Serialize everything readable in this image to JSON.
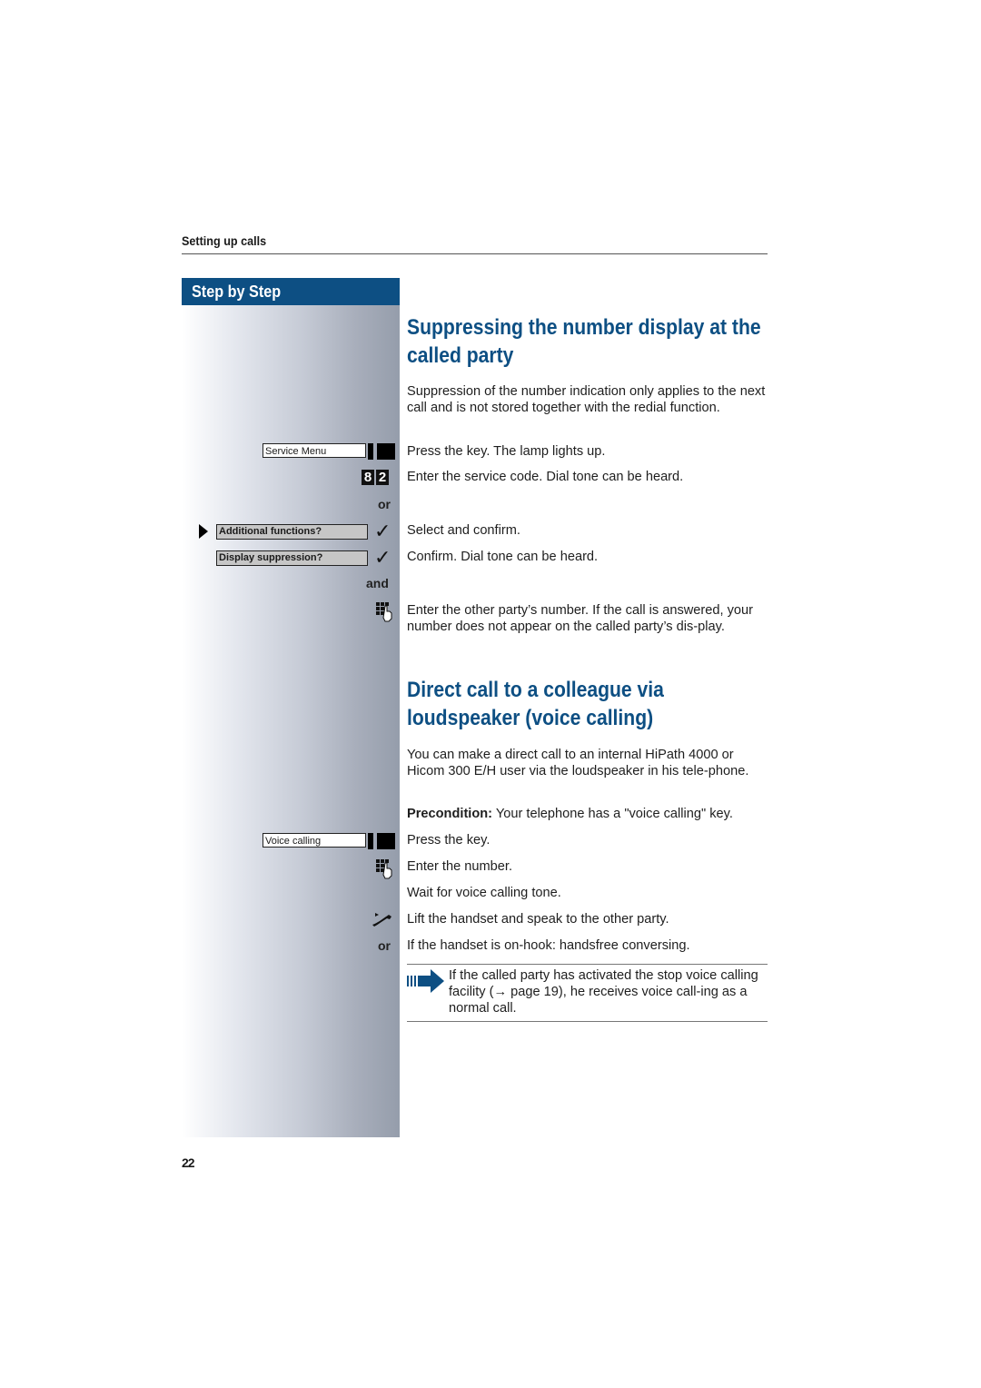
{
  "header": {
    "section_title": "Setting up calls",
    "sidebar_title": "Step by Step"
  },
  "colors": {
    "brand_blue": "#0d4f83",
    "sidebar_gradient_start": "#ffffff",
    "sidebar_gradient_end": "#959dab"
  },
  "section1": {
    "title_line1": "Suppressing the number display at the",
    "title_line2": "called party",
    "intro": "Suppression of the number indication only applies to the next call and is not stored together with the redial function.",
    "steps": [
      {
        "control": {
          "type": "key",
          "label": "Service Menu"
        },
        "text": "Press the key. The lamp lights up."
      },
      {
        "control": {
          "type": "digits",
          "digits": [
            "8",
            "2"
          ]
        },
        "text": "Enter the service code. Dial tone can be heard."
      },
      {
        "control": {
          "type": "connector",
          "label": "or"
        },
        "text": ""
      },
      {
        "control": {
          "type": "menu",
          "label": "Additional functions?",
          "selected": true,
          "icon": "check-icon"
        },
        "text": "Select and confirm."
      },
      {
        "control": {
          "type": "menu",
          "label": "Display suppression?",
          "selected": false,
          "icon": "check-icon"
        },
        "text": "Confirm. Dial tone can be heard."
      },
      {
        "control": {
          "type": "connector",
          "label": "and"
        },
        "text": ""
      },
      {
        "control": {
          "type": "icon",
          "icon": "keypad-dial-icon"
        },
        "text": "Enter the other party’s number. If the call is answered, your number does not appear on the called party’s dis-play."
      }
    ]
  },
  "section2": {
    "title_line1": "Direct call to a colleague via",
    "title_line2": "loudspeaker (voice calling)",
    "intro": "You can make a direct call to an internal HiPath 4000 or Hicom 300 E/H user via the loudspeaker in his tele-phone.",
    "precondition_label": "Precondition:",
    "precondition_text": " Your telephone has a \"voice calling\" key.",
    "steps": [
      {
        "control": {
          "type": "key",
          "label": "Voice calling"
        },
        "text": "Press the key."
      },
      {
        "control": {
          "type": "icon",
          "icon": "keypad-dial-icon"
        },
        "text": "Enter the number."
      },
      {
        "control": {
          "type": "none"
        },
        "text": "Wait for voice calling tone."
      },
      {
        "control": {
          "type": "icon",
          "icon": "lift-handset-icon"
        },
        "text": "Lift the handset and speak to the other party."
      },
      {
        "control": {
          "type": "connector",
          "label": "or"
        },
        "text": "If the handset is on-hook: handsfree conversing."
      }
    ],
    "note": {
      "icon": "note-arrow-icon",
      "text": "If the called party has activated the stop voice calling facility (→ page 19), he receives voice call-ing as a normal call."
    }
  },
  "footer": {
    "page_number": "22"
  }
}
